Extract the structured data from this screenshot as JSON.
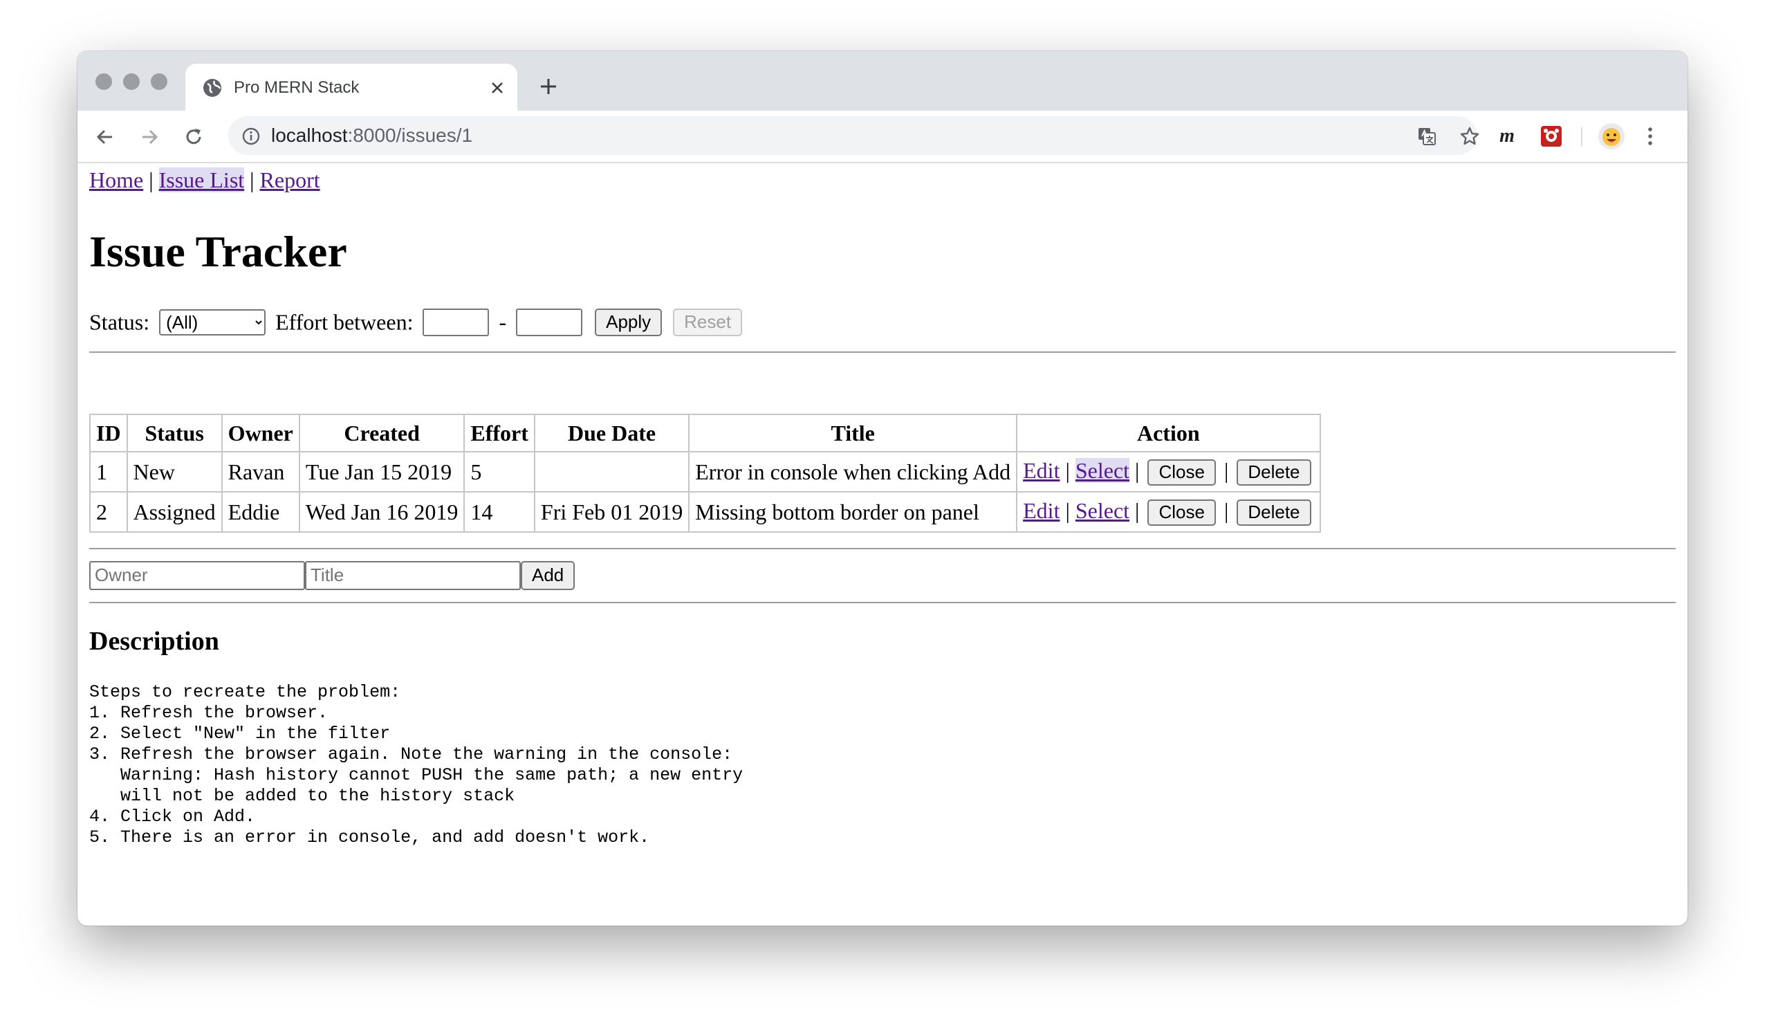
{
  "browser": {
    "tab_title": "Pro MERN Stack",
    "url_host": "localhost",
    "url_rest": ":8000/issues/1"
  },
  "nav": {
    "home": "Home",
    "issue_list": "Issue List",
    "report": "Report",
    "separator": "|"
  },
  "heading": "Issue Tracker",
  "filter": {
    "status_label": "Status:",
    "status_value": "(All)",
    "effort_label": "Effort between:",
    "dash": "-",
    "apply": "Apply",
    "reset": "Reset"
  },
  "table": {
    "headers": [
      "ID",
      "Status",
      "Owner",
      "Created",
      "Effort",
      "Due Date",
      "Title",
      "Action"
    ],
    "rows": [
      {
        "id": "1",
        "status": "New",
        "owner": "Ravan",
        "created": "Tue Jan 15 2019",
        "effort": "5",
        "due": "",
        "title": "Error in console when clicking Add"
      },
      {
        "id": "2",
        "status": "Assigned",
        "owner": "Eddie",
        "created": "Wed Jan 16 2019",
        "effort": "14",
        "due": "Fri Feb 01 2019",
        "title": "Missing bottom border on panel"
      }
    ],
    "actions": {
      "edit": "Edit",
      "select": "Select",
      "close": "Close",
      "delete": "Delete",
      "separator": "|"
    }
  },
  "add_form": {
    "owner_placeholder": "Owner",
    "title_placeholder": "Title",
    "add": "Add"
  },
  "description": {
    "heading": "Description",
    "text": "Steps to recreate the problem:\n1. Refresh the browser.\n2. Select \"New\" in the filter\n3. Refresh the browser again. Note the warning in the console:\n   Warning: Hash history cannot PUSH the same path; a new entry\n   will not be added to the history stack\n4. Click on Add.\n5. There is an error in console, and add doesn't work."
  }
}
